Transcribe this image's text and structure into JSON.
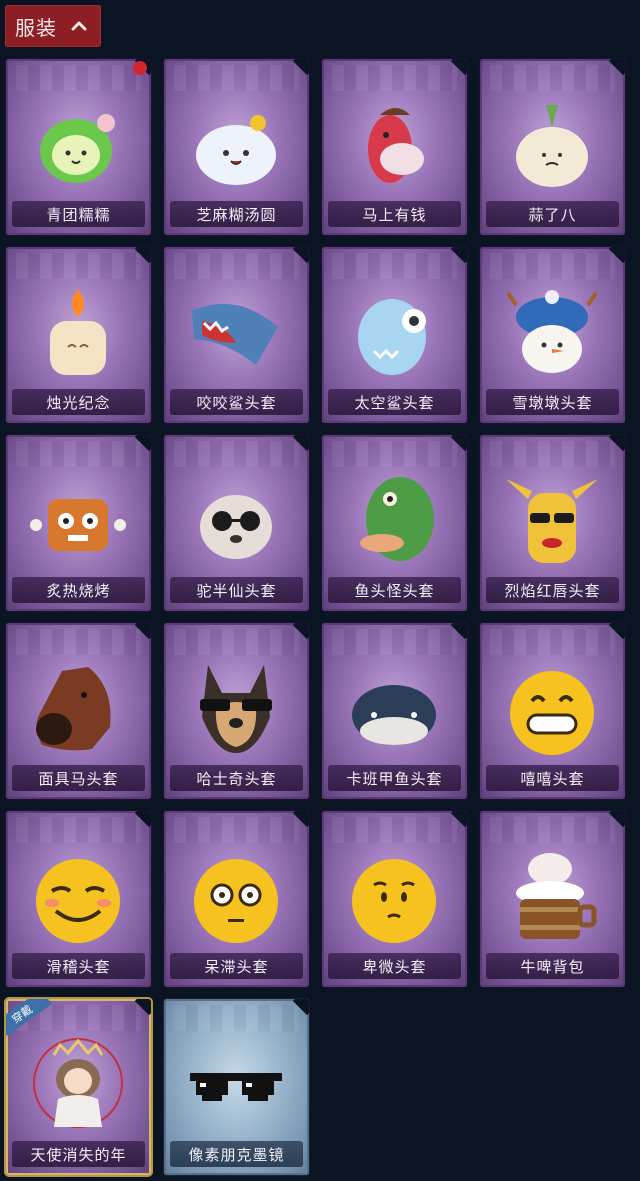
{
  "tab": {
    "label": "服装"
  },
  "items": [
    {
      "name": "青团糯糯",
      "icon": "green-mochi-icon",
      "badge": true
    },
    {
      "name": "芝麻糊汤圆",
      "icon": "white-dumpling-icon"
    },
    {
      "name": "马上有钱",
      "icon": "red-horse-icon"
    },
    {
      "name": "蒜了八",
      "icon": "garlic-icon"
    },
    {
      "name": "烛光纪念",
      "icon": "candle-icon"
    },
    {
      "name": "咬咬鲨头套",
      "icon": "shark-icon"
    },
    {
      "name": "太空鲨头套",
      "icon": "space-shark-icon"
    },
    {
      "name": "雪墩墩头套",
      "icon": "snowman-icon"
    },
    {
      "name": "炙热烧烤",
      "icon": "bbq-meat-icon"
    },
    {
      "name": "驼半仙头套",
      "icon": "raccoon-sunglasses-icon"
    },
    {
      "name": "鱼头怪头套",
      "icon": "fish-head-icon"
    },
    {
      "name": "烈焰红唇头套",
      "icon": "yellow-mask-icon"
    },
    {
      "name": "面具马头套",
      "icon": "horse-mask-icon"
    },
    {
      "name": "哈士奇头套",
      "icon": "husky-icon"
    },
    {
      "name": "卡班甲鱼头套",
      "icon": "whale-icon"
    },
    {
      "name": "嘻嘻头套",
      "icon": "grin-emoji-icon"
    },
    {
      "name": "滑稽头套",
      "icon": "smirk-emoji-icon"
    },
    {
      "name": "呆滞头套",
      "icon": "blank-emoji-icon"
    },
    {
      "name": "卑微头套",
      "icon": "humble-emoji-icon"
    },
    {
      "name": "牛啤背包",
      "icon": "cow-barrel-icon"
    },
    {
      "name": "天使消失的年",
      "icon": "angel-girl-icon",
      "worn_label": "穿戴"
    },
    {
      "name": "像素朋克墨镜",
      "icon": "pixel-sunglasses-icon"
    }
  ],
  "colors": {
    "tab_bg": "#8c1e24",
    "card_purple": "#9a76b9",
    "card_blue": "#9bb8cf",
    "badge": "#d32530",
    "worn_tag": "#3d6fa8"
  }
}
